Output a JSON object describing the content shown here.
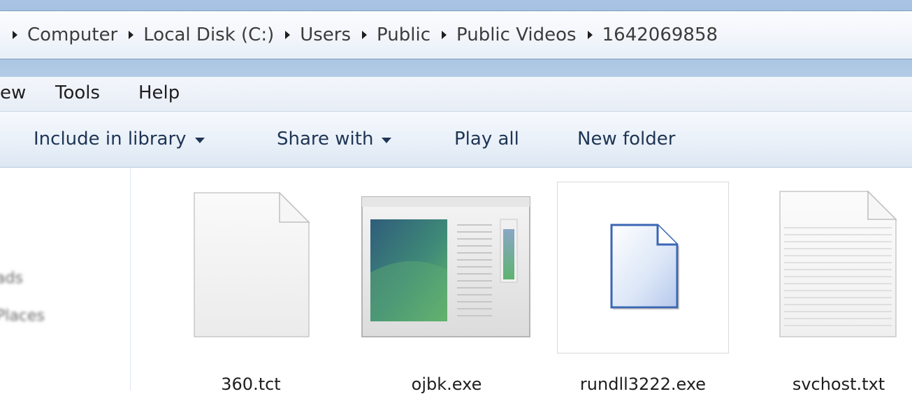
{
  "breadcrumb": [
    {
      "label": "Computer"
    },
    {
      "label": "Local Disk (C:)"
    },
    {
      "label": "Users"
    },
    {
      "label": "Public"
    },
    {
      "label": "Public Videos"
    },
    {
      "label": "1642069858"
    }
  ],
  "menu": {
    "view_partial": "ew",
    "tools": "Tools",
    "help": "Help"
  },
  "toolbar": {
    "include_in_library": "Include in library",
    "share_with": "Share with",
    "play_all": "Play all",
    "new_folder": "New folder"
  },
  "nav": {
    "items": [
      "",
      "ads",
      "Places"
    ]
  },
  "files": [
    {
      "name": "360.tct",
      "icon": "blank-document-icon"
    },
    {
      "name": "ojbk.exe",
      "icon": "application-window-icon"
    },
    {
      "name": "rundll3222.exe",
      "icon": "generic-file-icon",
      "selected": true
    },
    {
      "name": "svchost.txt",
      "icon": "text-document-icon"
    }
  ],
  "colors": {
    "address_bg": "#f2f6fb",
    "window_frame": "#a9c4e4",
    "command_text": "#1e3555"
  }
}
